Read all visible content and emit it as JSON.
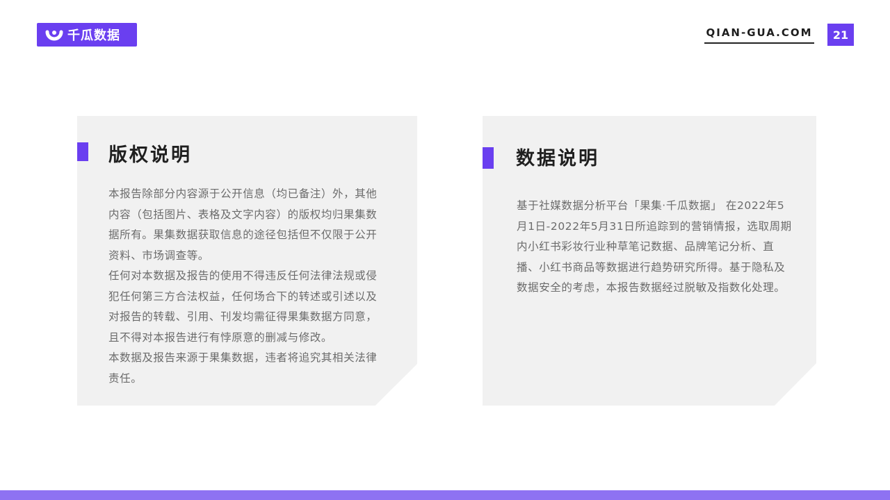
{
  "header": {
    "logo_text": "千瓜数据",
    "site_url": "QIAN-GUA.COM",
    "page_number": "21"
  },
  "copyright_card": {
    "title": "版权说明",
    "paragraphs": [
      "本报告除部分内容源于公开信息（均已备注）外，其他内容（包括图片、表格及文字内容）的版权均归果集数据所有。果集数据获取信息的途径包括但不仅限于公开资料、市场调查等。",
      "任何对本数据及报告的使用不得违反任何法律法规或侵犯任何第三方合法权益，任何场合下的转述或引述以及对报告的转载、引用、刊发均需征得果集数据方同意，且不得对本报告进行有悖原意的删减与修改。",
      "本数据及报告来源于果集数据，违者将追究其相关法律责任。"
    ]
  },
  "data_card": {
    "title": "数据说明",
    "paragraphs": [
      "基于社媒数据分析平台「果集·千瓜数据」 在2022年5月1日-2022年5月31日所追踪到的营销情报，选取周期内小红书彩妆行业种草笔记数据、品牌笔记分析、直播、小红书商品等数据进行趋势研究所得。基于隐私及数据安全的考虑，本报告数据经过脱敏及指数化处理。"
    ]
  },
  "colors": {
    "accent": "#6a3ff0",
    "bottom_bar": "#8e72f2",
    "card_bg": "#f1f1f1"
  }
}
